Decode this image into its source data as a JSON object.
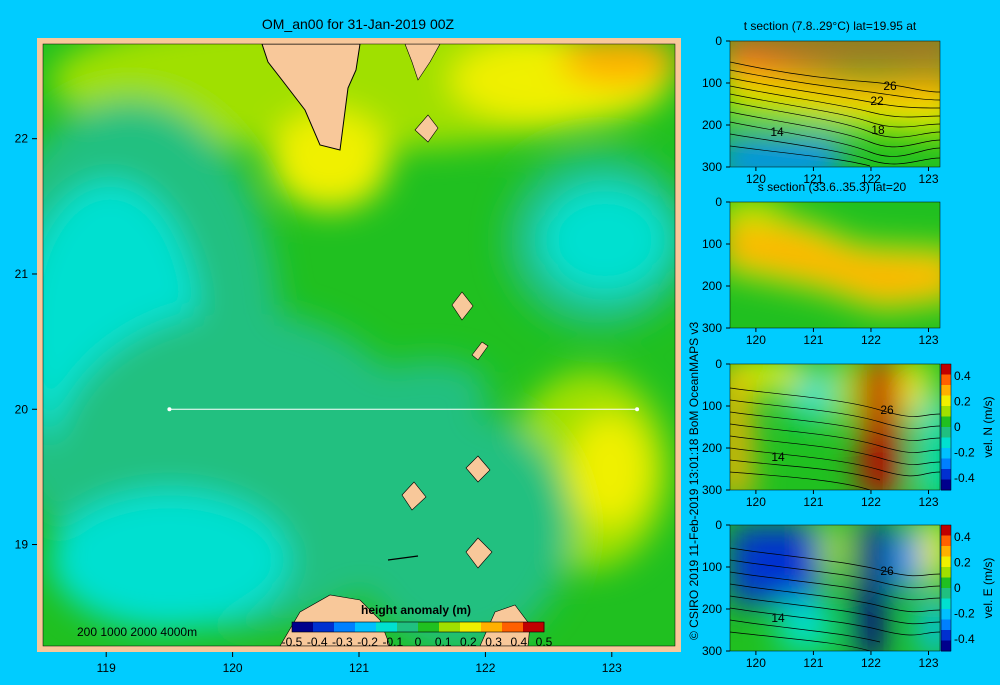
{
  "main_map": {
    "title": "OM_an00 for 31-Jan-2019 00Z",
    "x_ticks": [
      "119",
      "120",
      "121",
      "122",
      "123"
    ],
    "y_ticks": [
      "22",
      "21",
      "20",
      "19"
    ],
    "depth_legend": "200  1000  2000  4000m",
    "colorbar_title": "height anomaly (m)",
    "colorbar_ticks": [
      "-0.5",
      "-0.4",
      "-0.3",
      "-0.2",
      "-0.1",
      "0",
      "0.1",
      "0.2",
      "0.3",
      "0.4",
      "0.5"
    ],
    "section_line": {
      "lon_start": 119.5,
      "lon_end": 123.2,
      "lat": 20.0
    },
    "lon_range": [
      118.5,
      123.5
    ],
    "lat_range": [
      18.25,
      22.7
    ]
  },
  "panels": [
    {
      "title": "t section (7.8..29°C) lat=19.95 at",
      "y_ticks": [
        "0",
        "100",
        "200",
        "300"
      ],
      "x_ticks": [
        "120",
        "121",
        "122",
        "123"
      ],
      "contour_labels": [
        "26",
        "22",
        "18",
        "14"
      ]
    },
    {
      "title": "s section (33.6..35.3) lat=20",
      "y_ticks": [
        "0",
        "100",
        "200",
        "300"
      ],
      "x_ticks": [
        "120",
        "121",
        "122",
        "123"
      ],
      "contour_labels": []
    },
    {
      "title": "",
      "y_ticks": [
        "0",
        "100",
        "200",
        "300"
      ],
      "x_ticks": [
        "120",
        "121",
        "122",
        "123"
      ],
      "contour_labels": [
        "26",
        "14"
      ],
      "colorbar_label": "vel. N (m/s)",
      "colorbar_ticks": [
        "0.4",
        "0.2",
        "0",
        "-0.2",
        "-0.4"
      ]
    },
    {
      "title": "",
      "y_ticks": [
        "0",
        "100",
        "200",
        "300"
      ],
      "x_ticks": [
        "120",
        "121",
        "122",
        "123"
      ],
      "contour_labels": [
        "26",
        "14"
      ],
      "colorbar_label": "vel. E (m/s)",
      "colorbar_ticks": [
        "0.4",
        "0.2",
        "0",
        "-0.2",
        "-0.4"
      ]
    }
  ],
  "credit": "© CSIRO 2019   11-Feb-2019 13:01:18 BoM OceanMAPS v3",
  "colors": {
    "background": "#00ccff",
    "land": "#f8c89a",
    "colorbar": [
      "#00008c",
      "#0030d0",
      "#0080ff",
      "#00c0ff",
      "#00e0d0",
      "#20c080",
      "#20c020",
      "#a0e000",
      "#f0f000",
      "#ffb000",
      "#ff6000",
      "#c00000"
    ]
  }
}
